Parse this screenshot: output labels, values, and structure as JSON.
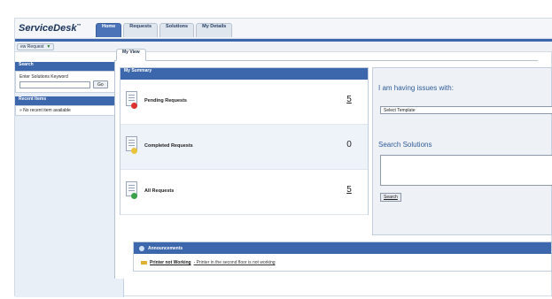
{
  "app": {
    "logo": "ServiceDesk",
    "logo_mark": "™"
  },
  "tabs": [
    {
      "label": "Home",
      "active": true
    },
    {
      "label": "Requests",
      "active": false
    },
    {
      "label": "Solutions",
      "active": false
    },
    {
      "label": "My Details",
      "active": false
    }
  ],
  "toolbar": {
    "new_request": "ew Request"
  },
  "sidebar": {
    "search_title": "Search",
    "search_label": "Enter Solutions Keyword",
    "search_value": "",
    "go_label": "Go",
    "recent_title": "Recent Items",
    "recent_empty": "No recent item available"
  },
  "main": {
    "view_tab": "My View",
    "summary_title": "My Summary",
    "rows": [
      {
        "label": "Pending Requests",
        "count": "5",
        "status": "red"
      },
      {
        "label": "Completed Requests",
        "count": "0",
        "status": "yellow"
      },
      {
        "label": "All Requests",
        "count": "5",
        "status": "green"
      }
    ],
    "issues_title": "I am having issues with:",
    "template_select": "Select Template",
    "search_solutions_title": "Search Solutions",
    "search_button": "Search",
    "announcements_title": "Announcements",
    "announcement": {
      "title": "Printer not Working",
      "desc": "- Printer in the second floor is not working"
    }
  },
  "colors": {
    "accent": "#3d67ac",
    "tab_active": "#4b73b8",
    "sidebar_bg": "#e9eff7"
  }
}
